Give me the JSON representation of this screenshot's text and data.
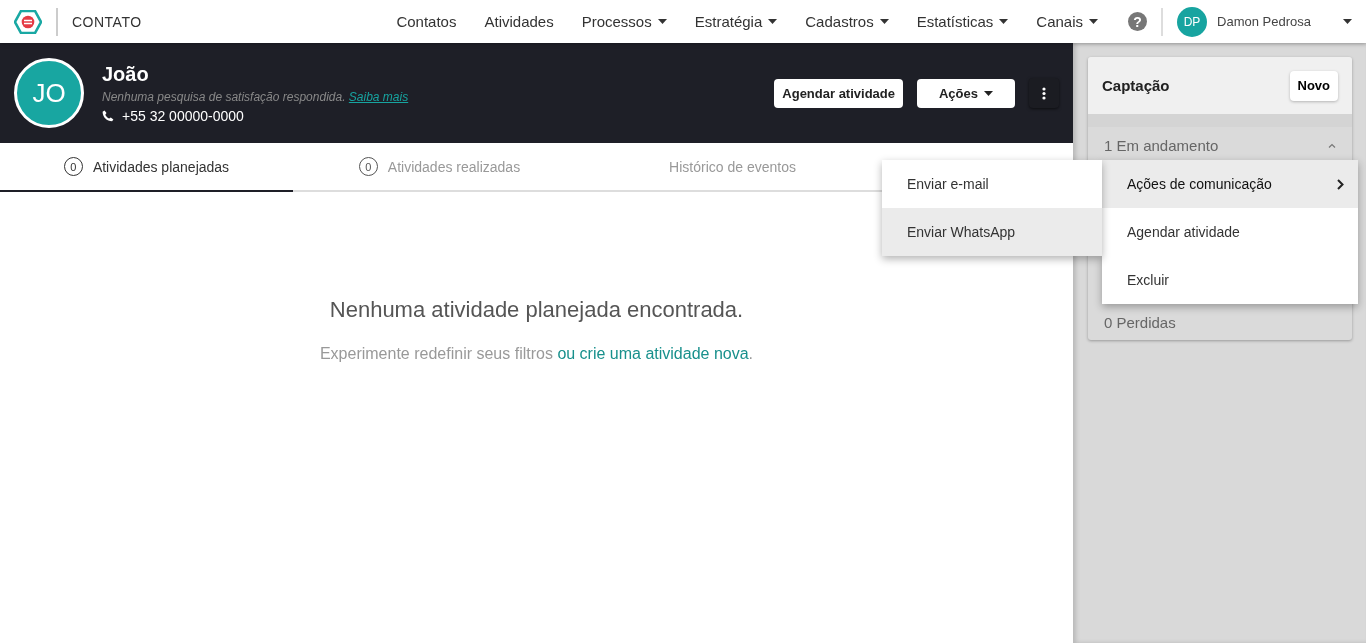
{
  "topbar": {
    "logo_title": "CONTATO",
    "nav": [
      {
        "label": "Contatos",
        "has_caret": false
      },
      {
        "label": "Atividades",
        "has_caret": false
      },
      {
        "label": "Processos",
        "has_caret": true
      },
      {
        "label": "Estratégia",
        "has_caret": true
      },
      {
        "label": "Cadastros",
        "has_caret": true
      },
      {
        "label": "Estatísticas",
        "has_caret": true
      },
      {
        "label": "Canais",
        "has_caret": true
      }
    ],
    "help": "?",
    "user": {
      "initials": "DP",
      "name": "Damon Pedrosa"
    }
  },
  "contact": {
    "initials": "JO",
    "name": "João",
    "survey": "Nenhuma pesquisa de satisfação respondida.",
    "survey_link": "Saiba mais",
    "phone": "+55 32 00000-0000",
    "buttons": [
      {
        "label": "Agendar atividade",
        "has_caret": false
      },
      {
        "label": "Ações",
        "has_caret": true
      }
    ]
  },
  "tabs": [
    {
      "count": "0",
      "label": "Atividades planejadas",
      "selected": true
    },
    {
      "count": "0",
      "label": "Atividades realizadas",
      "selected": false
    },
    {
      "label": "Histórico de eventos",
      "selected": false
    }
  ],
  "empty": {
    "title": "Nenhuma atividade planejada encontrada.",
    "text": "Experimente redefinir seus filtros",
    "link": "ou crie uma atividade nova",
    "end": "."
  },
  "pipeline": {
    "title": "Captação",
    "new_button": "Novo",
    "stages": [
      {
        "label": "1 Em andamento",
        "expanded": true
      },
      {
        "label": "0 Perdidas",
        "expanded": false
      }
    ]
  },
  "actions_menu": [
    {
      "label": "Ações de comunicação",
      "has_submenu": true,
      "selected": true
    },
    {
      "label": "Agendar atividade",
      "has_submenu": false,
      "selected": false
    },
    {
      "label": "Excluir",
      "has_submenu": false,
      "selected": false
    }
  ],
  "submenu": [
    {
      "label": "Enviar e-mail",
      "selected": false
    },
    {
      "label": "Enviar WhatsApp",
      "selected": true
    }
  ]
}
